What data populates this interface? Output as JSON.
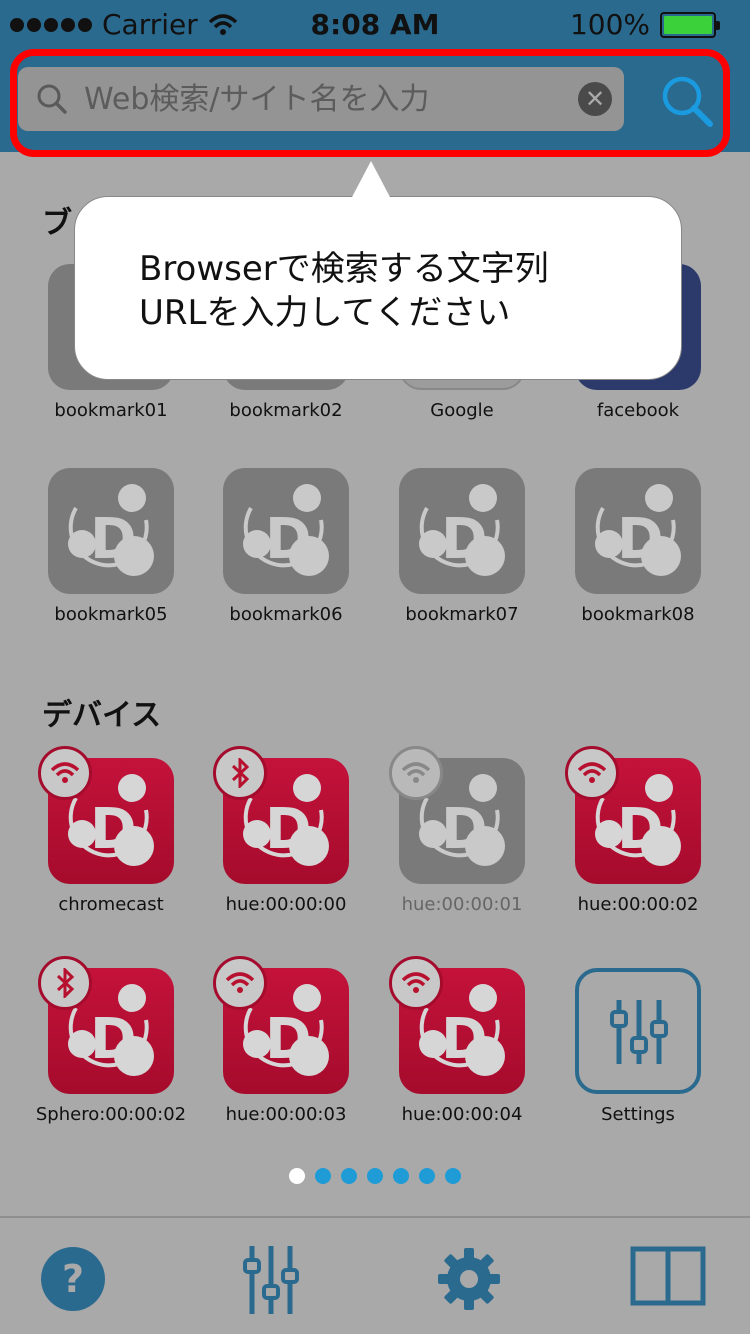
{
  "status_bar": {
    "carrier": "Carrier",
    "time": "8:08 AM",
    "battery": "100%"
  },
  "search": {
    "placeholder": "Web検索/サイト名を入力"
  },
  "tooltip": {
    "line1": "Browserで検索する文字列",
    "line2": "URLを入力してください"
  },
  "bookmarks": {
    "section_title": "ブックマーク",
    "items": [
      {
        "label": "bookmark01",
        "icon": "bookmark-icon"
      },
      {
        "label": "bookmark02",
        "icon": "bookmark-icon"
      },
      {
        "label": "Google",
        "icon": "google-icon"
      },
      {
        "label": "facebook",
        "icon": "facebook-icon"
      },
      {
        "label": "bookmark05",
        "icon": "bookmark-icon"
      },
      {
        "label": "bookmark06",
        "icon": "bookmark-icon"
      },
      {
        "label": "bookmark07",
        "icon": "bookmark-icon"
      },
      {
        "label": "bookmark08",
        "icon": "bookmark-icon"
      }
    ]
  },
  "devices": {
    "section_title": "デバイス",
    "items": [
      {
        "label": "chromecast",
        "connection": "wifi",
        "state": "active"
      },
      {
        "label": "hue:00:00:00",
        "connection": "bluetooth",
        "state": "active"
      },
      {
        "label": "hue:00:00:01",
        "connection": "wifi",
        "state": "inactive"
      },
      {
        "label": "hue:00:00:02",
        "connection": "wifi",
        "state": "active"
      },
      {
        "label": "Sphero:00:00:02",
        "connection": "bluetooth",
        "state": "active"
      },
      {
        "label": "hue:00:00:03",
        "connection": "wifi",
        "state": "active"
      },
      {
        "label": "hue:00:00:04",
        "connection": "wifi",
        "state": "active"
      },
      {
        "label": "Settings",
        "connection": "none",
        "state": "settings"
      }
    ]
  },
  "pager": {
    "pages": 7,
    "current": 1
  },
  "tab_bar": {
    "items": [
      "help-icon",
      "sliders-icon",
      "gear-icon",
      "book-icon"
    ]
  },
  "colors": {
    "accent": "#2b6a8f",
    "device_red": "#b8102f",
    "pager_active": "#ffffff",
    "pager_dot": "#1f9bd6",
    "highlight": "#ff0000"
  }
}
